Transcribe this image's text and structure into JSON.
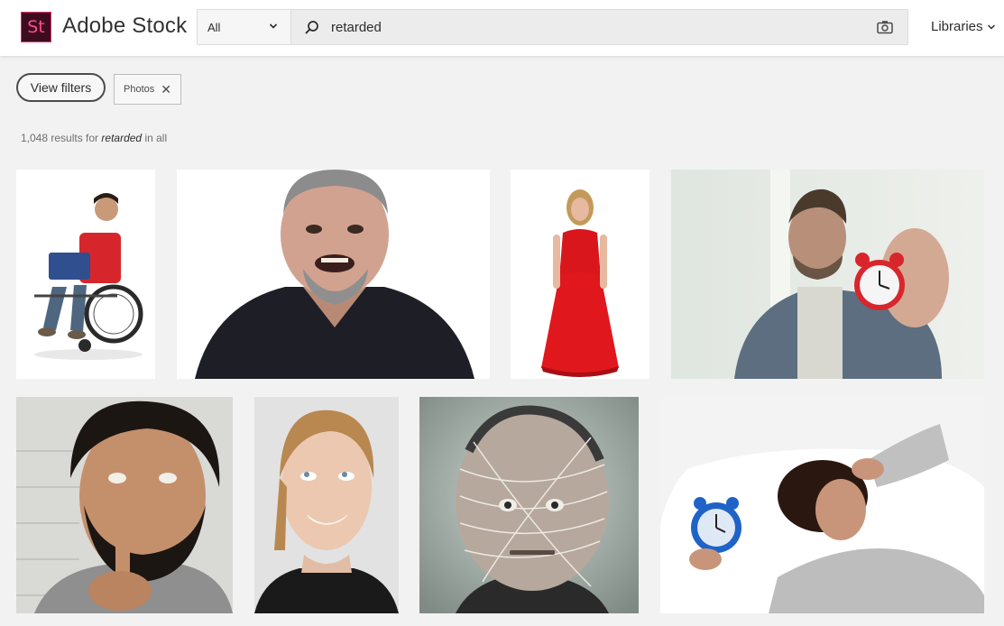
{
  "header": {
    "logo_text": "St",
    "brand": "Adobe Stock",
    "scope_label": "All",
    "search_query": "retarded",
    "libraries_label": "Libraries"
  },
  "filters": {
    "view_filters_label": "View filters",
    "active_chip_label": "Photos"
  },
  "results": {
    "count": "1,048",
    "prefix_text": "results for",
    "query": "retarded",
    "suffix_text": "in all"
  },
  "colors": {
    "accent": "#e0306f",
    "logo_bg": "#3d0c1f",
    "page_bg": "#f2f2f2"
  },
  "icons": [
    "chevron-down-icon",
    "search-icon",
    "camera-icon",
    "close-icon"
  ],
  "images": [
    {
      "name": "boy-in-wheelchair-with-laptop"
    },
    {
      "name": "smiling-bearded-man"
    },
    {
      "name": "girl-in-red-dress"
    },
    {
      "name": "man-holding-red-alarm-clock"
    },
    {
      "name": "bearded-man-finger-on-nose"
    },
    {
      "name": "smiling-woman-looking-up"
    },
    {
      "name": "man-face-wrapped-in-string"
    },
    {
      "name": "woman-in-bed-with-blue-alarm-clock"
    }
  ]
}
